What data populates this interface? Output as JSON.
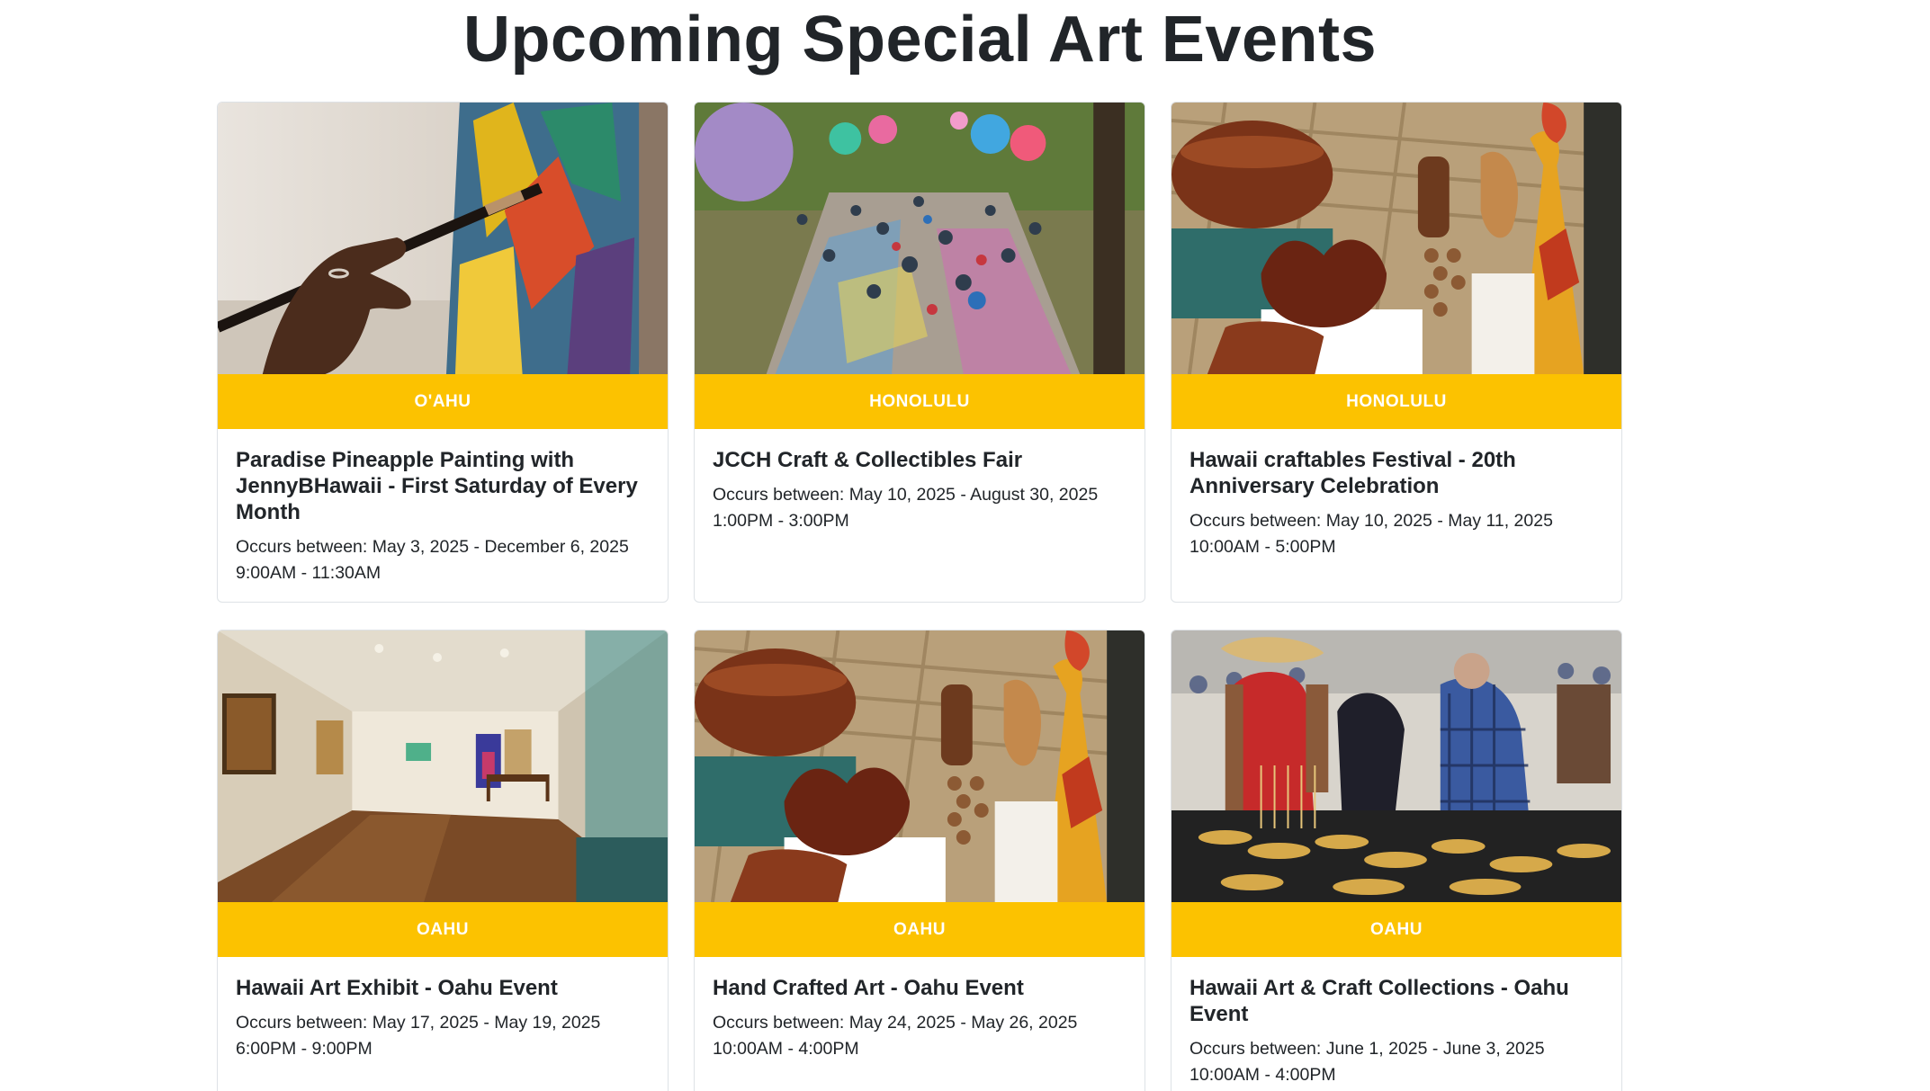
{
  "page": {
    "title": "Upcoming Special Art Events"
  },
  "colors": {
    "badge_bg": "#fcc200",
    "badge_text": "#ffffff",
    "text": "#212529",
    "card_border": "#dee2e6"
  },
  "events": [
    {
      "location": "O'AHU",
      "title": "Paradise Pineapple Painting with JennyBHawaii - First Saturday of Every Month",
      "dates": "Occurs between: May 3, 2025 - December 6, 2025 9:00AM - 11:30AM",
      "image": "painting-brush-canvas"
    },
    {
      "location": "HONOLULU",
      "title": "JCCH Craft & Collectibles Fair",
      "dates": "Occurs between: May 10, 2025 - August 30, 2025 1:00PM - 3:00PM",
      "image": "crowded-fair-balloons"
    },
    {
      "location": "HONOLULU",
      "title": "Hawaii craftables Festival - 20th Anniversary Celebration",
      "dates": "Occurs between: May 10, 2025 - May 11, 2025 10:00AM - 5:00PM",
      "image": "wooden-bowls-crafts"
    },
    {
      "location": "OAHU",
      "title": "Hawaii Art Exhibit - Oahu Event",
      "dates": "Occurs between: May 17, 2025 - May 19, 2025 6:00PM - 9:00PM",
      "image": "gallery-interior"
    },
    {
      "location": "OAHU",
      "title": "Hand Crafted Art - Oahu Event",
      "dates": "Occurs between: May 24, 2025 - May 26, 2025 10:00AM - 4:00PM",
      "image": "wooden-bowls-crafts"
    },
    {
      "location": "OAHU",
      "title": "Hawaii Art & Craft Collections - Oahu Event",
      "dates": "Occurs between: June 1, 2025 - June 3, 2025 10:00AM - 4:00PM",
      "image": "craft-market-jewelry"
    }
  ]
}
